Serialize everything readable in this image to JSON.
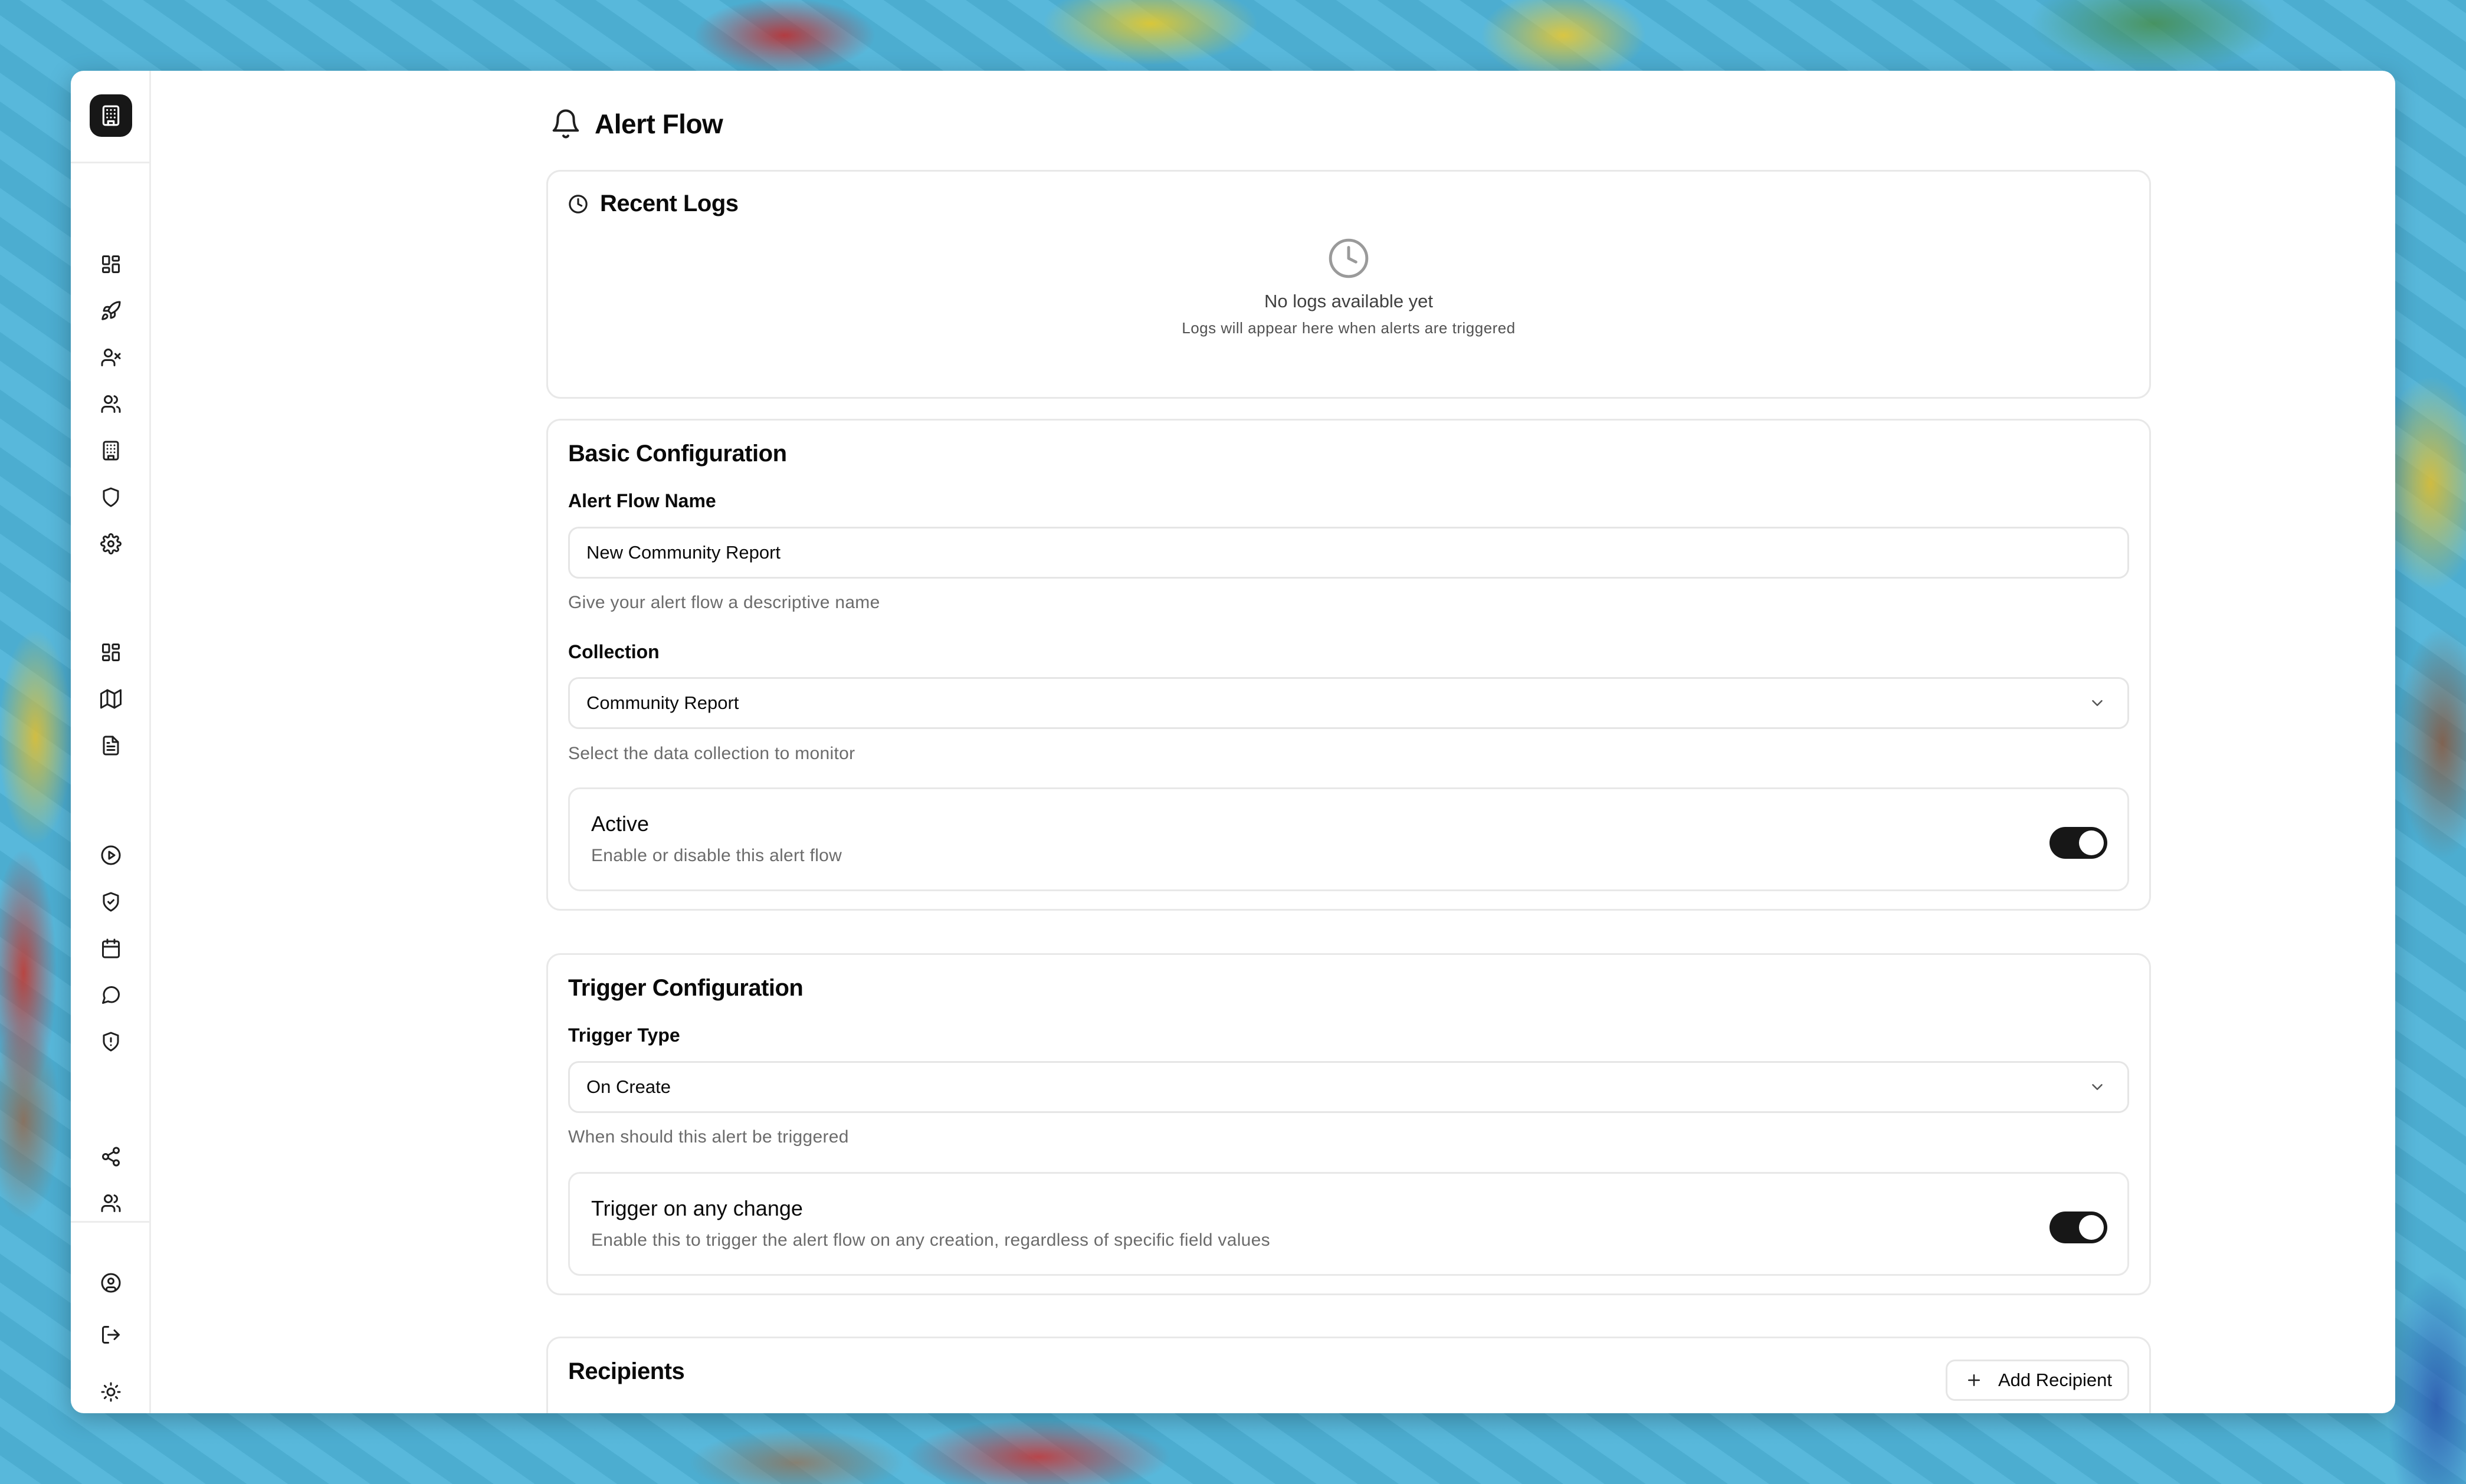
{
  "page": {
    "title": "Alert Flow"
  },
  "sidebar": {
    "icons": [
      "building-icon",
      "dashboard-icon",
      "rocket-icon",
      "user-x-icon",
      "users-icon",
      "building-icon",
      "shield-icon",
      "gear-icon",
      "dashboard-icon",
      "map-icon",
      "file-text-icon",
      "play-circle-icon",
      "shield-check-icon",
      "calendar-icon",
      "message-circle-icon",
      "shield-alert-icon",
      "share-icon",
      "users-icon",
      "user-circle-icon",
      "logout-icon",
      "sun-icon"
    ]
  },
  "recent_logs": {
    "title": "Recent Logs",
    "empty_title": "No logs available yet",
    "empty_subtitle": "Logs will appear here when alerts are triggered"
  },
  "basic": {
    "title": "Basic Configuration",
    "name_label": "Alert Flow Name",
    "name_value": "New Community Report",
    "name_help": "Give your alert flow a descriptive name",
    "collection_label": "Collection",
    "collection_value": "Community Report",
    "collection_help": "Select the data collection to monitor",
    "active_title": "Active",
    "active_desc": "Enable or disable this alert flow",
    "active_on": true
  },
  "trigger": {
    "title": "Trigger Configuration",
    "type_label": "Trigger Type",
    "type_value": "On Create",
    "type_help": "When should this alert be triggered",
    "any_change_title": "Trigger on any change",
    "any_change_desc": "Enable this to trigger the alert flow on any creation, regardless of specific field values",
    "any_change_on": true
  },
  "recipients": {
    "title": "Recipients",
    "add_label": "Add Recipient"
  },
  "colors": {
    "accent": "#171717",
    "border": "#e8e8e8",
    "muted_text": "#6b6b6b"
  }
}
